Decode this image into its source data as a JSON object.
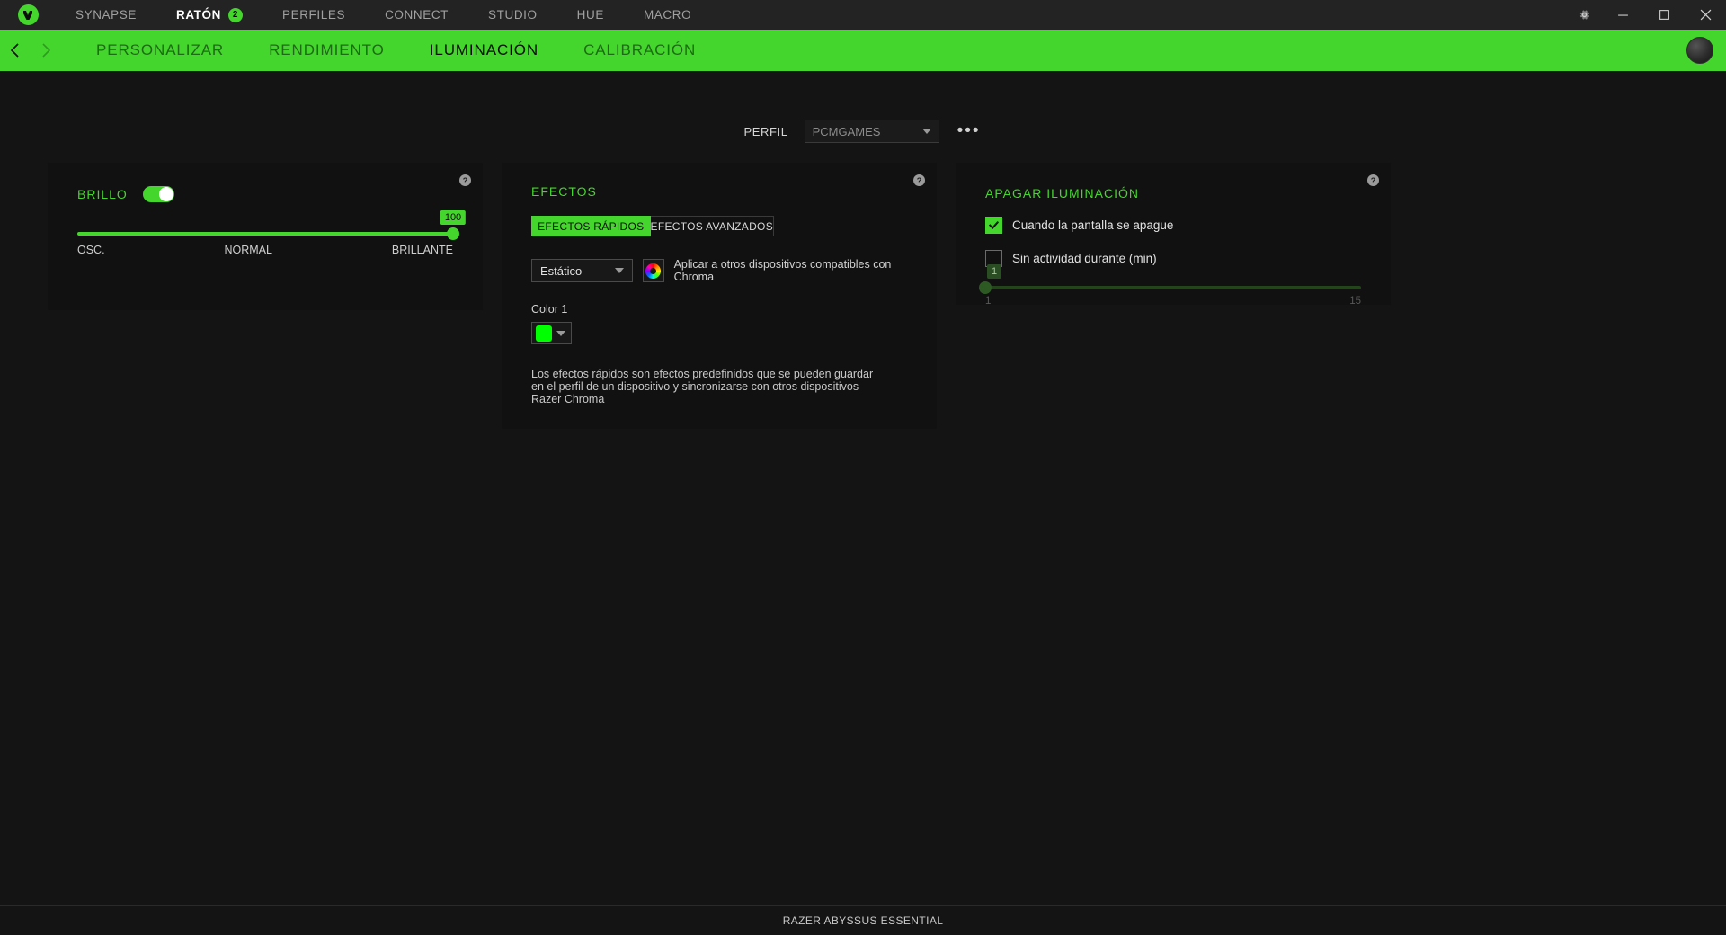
{
  "titlebar": {
    "logo_icon": "razer-logo-icon",
    "tabs": [
      {
        "label": "SYNAPSE",
        "active": false,
        "badge": null
      },
      {
        "label": "RATÓN",
        "active": true,
        "badge": "2"
      },
      {
        "label": "PERFILES",
        "active": false,
        "badge": null
      },
      {
        "label": "CONNECT",
        "active": false,
        "badge": null
      },
      {
        "label": "STUDIO",
        "active": false,
        "badge": null
      },
      {
        "label": "HUE",
        "active": false,
        "badge": null
      },
      {
        "label": "MACRO",
        "active": false,
        "badge": null
      }
    ],
    "controls": {
      "settings": "gear-icon",
      "minimize": "minimize-icon",
      "maximize": "maximize-icon",
      "close": "close-icon"
    }
  },
  "subnav": {
    "back_icon": "chevron-left-icon",
    "forward_icon": "chevron-right-icon",
    "tabs": [
      {
        "label": "PERSONALIZAR",
        "active": false
      },
      {
        "label": "RENDIMIENTO",
        "active": false
      },
      {
        "label": "ILUMINACIÓN",
        "active": true
      },
      {
        "label": "CALIBRACIÓN",
        "active": false
      }
    ],
    "avatar": "user-avatar"
  },
  "profile": {
    "label": "PERFIL",
    "selected": "PCMGAMES",
    "more_label": "•••"
  },
  "brightness": {
    "title": "BRILLO",
    "help": "?",
    "toggle_on": true,
    "value": "100",
    "value_percent": 100,
    "labels": {
      "min": "OSC.",
      "mid": "NORMAL",
      "max": "BRILLANTE"
    }
  },
  "effects": {
    "title": "EFECTOS",
    "help": "?",
    "tabs": [
      {
        "label": "EFECTOS RÁPIDOS",
        "active": true
      },
      {
        "label": "EFECTOS AVANZADOS",
        "active": false
      }
    ],
    "effect_selected": "Estático",
    "chroma_icon": "chroma-wheel-icon",
    "chroma_text": "Aplicar a otros dispositivos compatibles con Chroma",
    "color_label": "Color 1",
    "color_value": "#00FF00",
    "description": "Los efectos rápidos son efectos predefinidos que se pueden guardar en el perfil de un dispositivo y sincronizarse con otros dispositivos Razer Chroma"
  },
  "off_lighting": {
    "title": "APAGAR ILUMINACIÓN",
    "help": "?",
    "options": [
      {
        "label": "Cuando la pantalla se apague",
        "checked": true
      },
      {
        "label": "Sin actividad durante (min)",
        "checked": false
      }
    ],
    "slider": {
      "value": "1",
      "min": "1",
      "max": "15",
      "percent": 0
    }
  },
  "footer": {
    "device": "RAZER ABYSSUS ESSENTIAL"
  },
  "colors": {
    "accent": "#44d62c",
    "titlebar_bg": "#232323",
    "content_bg": "#141414",
    "panel_bg": "#111111"
  }
}
